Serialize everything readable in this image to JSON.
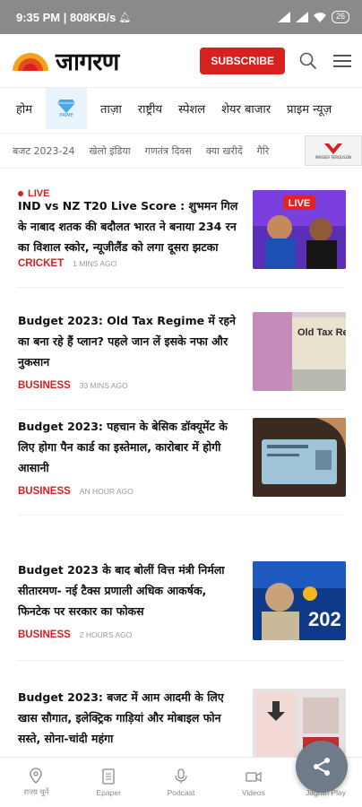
{
  "status_bar": {
    "time": "9:35 PM | 808KB/s",
    "battery": "26"
  },
  "header": {
    "logo_text": "जागरण",
    "subscribe_label": "SUBSCRIBE"
  },
  "nav_tabs": [
    "होम",
    "ताज़ा",
    "राष्ट्रीय",
    "स्पेशल",
    "शेयर बाजार",
    "प्राइम न्यूज़"
  ],
  "nav_diamond_label": "PRIME",
  "topics": [
    "बजट 2023-24",
    "खेलो इंडिया",
    "गणतंत्र दिवस",
    "क्या खरीदें",
    "गैरि"
  ],
  "topics_ad_label": "MASSEY FERGUSON",
  "articles": [
    {
      "live_label": "LIVE",
      "title": "IND vs NZ T20 Live Score : शुभमन गिल के नाबाद शतक की बदौलत भारत ने बनाया 234 रन का विशाल स्कोर, न्यूजीलैंड को लगा दूसरा झटका",
      "category": "CRICKET",
      "time": "1 MINS AGO"
    },
    {
      "title": "Budget 2023: Old Tax Regime में रहने का बना रहे हैं प्लान? पहले जान लें इसके नफा और नुकसान",
      "category": "BUSINESS",
      "time": "33 MINS AGO"
    },
    {
      "title": "Budget 2023: पहचान के बेसिक डॉक्यूमेंट के लिए होगा पैन कार्ड का इस्तेमाल, कारोबार में होगी आसानी",
      "category": "BUSINESS",
      "time": "AN HOUR AGO"
    },
    {
      "title": "Budget 2023 के बाद बोलीं वित्त मंत्री निर्मला सीतारमण- नई टैक्स प्रणाली अधिक आकर्षक, फिनटेक पर सरकार का फोकस",
      "category": "BUSINESS",
      "time": "2 HOURS AGO"
    },
    {
      "title": "Budget 2023: बजट में आम आदमी के लिए खास सौगात, इलेक्ट्रिक गाड़ियां और मोबाइल फोन सस्ते, सोना-चांदी महंगा",
      "category": "",
      "time": ""
    }
  ],
  "thumb_texts": {
    "t1_live": "LIVE",
    "t2_text": "Old Tax Regim",
    "t4_text": "202"
  },
  "bottom_nav": [
    "राज्य चुनें",
    "Epaper",
    "Podcast",
    "Videos",
    "Jagran Play"
  ]
}
